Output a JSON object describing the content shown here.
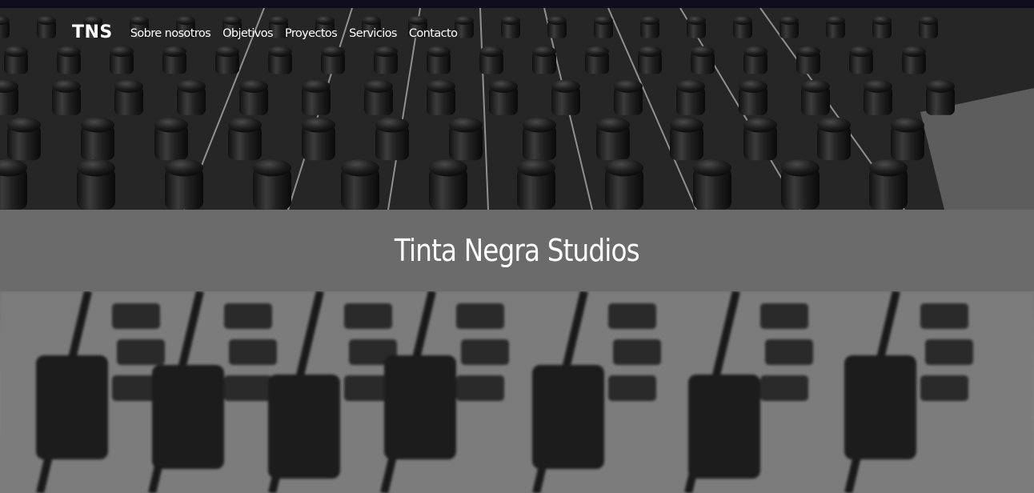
{
  "navbar": {
    "brand": "TNS",
    "links": [
      {
        "label": "Sobre nosotros"
      },
      {
        "label": "Objetivos"
      },
      {
        "label": "Proyectos"
      },
      {
        "label": "Servicios"
      },
      {
        "label": "Contacto"
      }
    ]
  },
  "hero": {
    "title": "Tinta Negra Studios"
  },
  "colors": {
    "band": "#6b6b6b",
    "topbar": "#0f0c1c",
    "text": "#ffffff"
  }
}
